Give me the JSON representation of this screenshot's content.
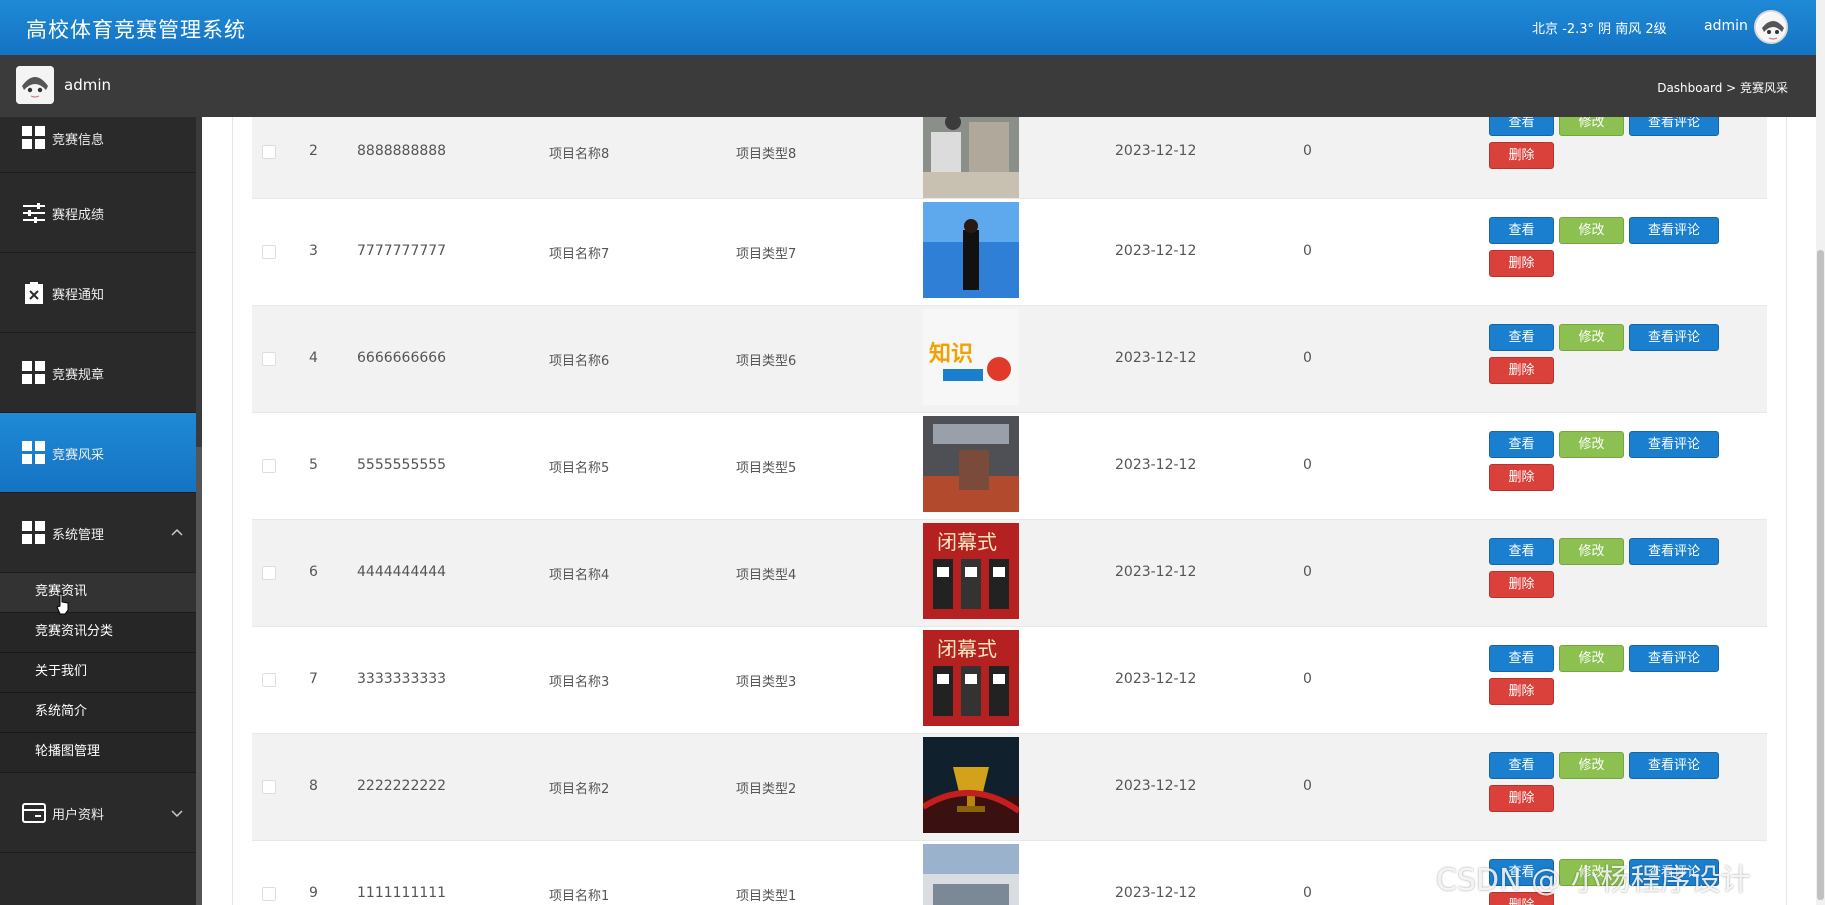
{
  "header": {
    "app_title": "高校体育竞赛管理系统",
    "weather": "北京  -2.3°  阴  南风  2级",
    "username": "admin"
  },
  "subheader": {
    "username": "admin",
    "breadcrumb": "Dashboard > 竞赛风采"
  },
  "sidebar": {
    "items": [
      {
        "label": "竞赛信息",
        "icon": "grid-icon"
      },
      {
        "label": "赛程成绩",
        "icon": "sliders-icon"
      },
      {
        "label": "赛程通知",
        "icon": "clipboard-icon"
      },
      {
        "label": "竞赛规章",
        "icon": "grid-icon"
      },
      {
        "label": "竞赛风采",
        "icon": "grid-icon",
        "active": true
      },
      {
        "label": "系统管理",
        "icon": "grid-icon",
        "expanded": true
      }
    ],
    "submenu": [
      "竞赛资讯",
      "竞赛资讯分类",
      "关于我们",
      "系统简介",
      "轮播图管理"
    ],
    "last_item": {
      "label": "用户资料",
      "icon": "card-icon"
    }
  },
  "table": {
    "buttons": {
      "view": "查看",
      "edit": "修改",
      "comments": "查看评论",
      "delete": "删除"
    },
    "rows": [
      {
        "no": "2",
        "code": "8888888888",
        "name": "项目名称8",
        "type": "项目类型8",
        "date": "2023-12-12",
        "count": "0"
      },
      {
        "no": "3",
        "code": "7777777777",
        "name": "项目名称7",
        "type": "项目类型7",
        "date": "2023-12-12",
        "count": "0"
      },
      {
        "no": "4",
        "code": "6666666666",
        "name": "项目名称6",
        "type": "项目类型6",
        "date": "2023-12-12",
        "count": "0"
      },
      {
        "no": "5",
        "code": "5555555555",
        "name": "项目名称5",
        "type": "项目类型5",
        "date": "2023-12-12",
        "count": "0"
      },
      {
        "no": "6",
        "code": "4444444444",
        "name": "项目名称4",
        "type": "项目类型4",
        "date": "2023-12-12",
        "count": "0"
      },
      {
        "no": "7",
        "code": "3333333333",
        "name": "项目名称3",
        "type": "项目类型3",
        "date": "2023-12-12",
        "count": "0"
      },
      {
        "no": "8",
        "code": "2222222222",
        "name": "项目名称2",
        "type": "项目类型2",
        "date": "2023-12-12",
        "count": "0"
      },
      {
        "no": "9",
        "code": "1111111111",
        "name": "项目名称1",
        "type": "项目类型1",
        "date": "2023-12-12",
        "count": "0"
      }
    ]
  },
  "watermark": "CSDN @ 小杨程序设计",
  "colors": {
    "primary": "#1a7fcf",
    "success": "#8cc152",
    "danger": "#d9413a",
    "sidebar": "#2a2a2a"
  }
}
